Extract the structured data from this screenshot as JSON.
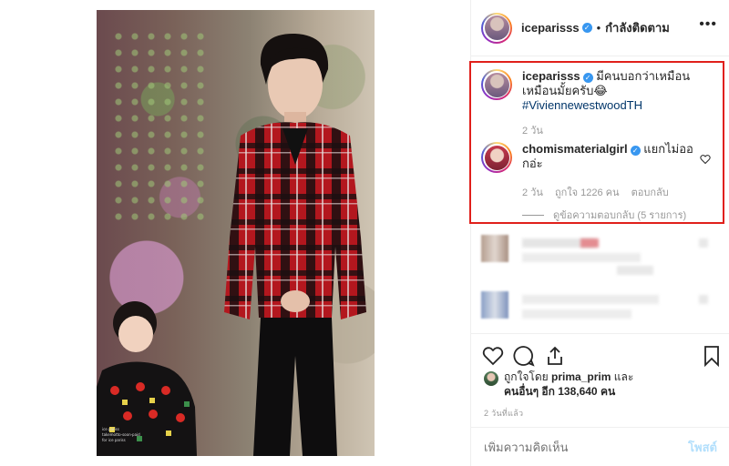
{
  "post": {
    "author": "iceparisss",
    "follow_status": "กำลังติดตาม",
    "more_glyph": "•••"
  },
  "photo": {
    "watermark_line1": "ice pariss",
    "watermark_line2": "takemotto-soon-paid",
    "watermark_line3": "for ice pariss"
  },
  "caption": {
    "author": "iceparisss",
    "text": "มีคนบอกว่าเหมือน เหมือนมั้ยครับ😂",
    "hashtag": "#ViviennewestwoodTH",
    "age": "2 วัน"
  },
  "reply": {
    "author": "chomismaterialgirl",
    "text": "แยกไม่ออกอ่ะ",
    "age": "2 วัน",
    "likes": "ถูกใจ 1226 คน",
    "reply_label": "ตอบกลับ",
    "view_replies": "ดูข้อความตอบกลับ (5 รายการ)"
  },
  "likes": {
    "prefix": "ถูกใจโดย",
    "liker": "prima_prim",
    "and": "และ",
    "others": "คนอื่นๆ อีก 138,640 คน"
  },
  "timestamp": "2 วันที่แล้ว",
  "comment_box": {
    "placeholder": "เพิ่มความคิดเห็น",
    "post_label": "โพสต์"
  },
  "colors": {
    "highlight": "#e0201b",
    "verified": "#3897f0",
    "hashtag": "#003569",
    "post_disabled": "#b2dffc"
  },
  "icons": [
    "verified-badge-icon",
    "heart-icon",
    "comment-icon",
    "share-icon",
    "bookmark-icon",
    "more-options-icon"
  ]
}
